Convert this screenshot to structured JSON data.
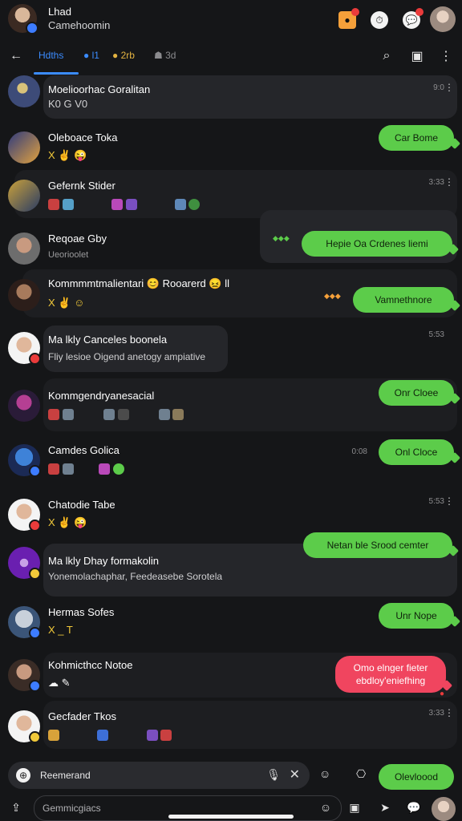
{
  "header": {
    "account_name": "Lhad",
    "account_sub": "Camehoomin",
    "icons": [
      "notification-icon",
      "timer-icon",
      "chat-bubble-icon"
    ]
  },
  "tabs": [
    {
      "label": "Hdths",
      "active": true
    },
    {
      "label": "l1"
    },
    {
      "label": "2rb"
    },
    {
      "label": "3d"
    }
  ],
  "rows": [
    {
      "name": "Moelioorhac Goralitan",
      "sub": "K0 G V0",
      "time": "9:0"
    },
    {
      "name": "Oleboace Toka",
      "sub": "X ✌ 😜",
      "reply": "Car Bome"
    },
    {
      "name": "Gefernk Stider",
      "sub": "",
      "time": "3:33"
    },
    {
      "name": "Reqoae Gby",
      "sub": "Ueorioolet",
      "reply": "Hepie Oa Crdenes liemi"
    },
    {
      "name": "Kommmmtmalientari",
      "sub": "Kommmmtmalientari 😊 Rooarerd 😖 ll",
      "sub2": "X ✌ ☺",
      "reply": "Vamnethnore"
    },
    {
      "name": "Ma lkly Canceles boonela",
      "sub": "Fliy lesioe Oigend anetogy ampiative",
      "time": "5:53"
    },
    {
      "name": "Kommgendryanesacial",
      "sub": "",
      "reply": "Onr Cloee"
    },
    {
      "name": "Camdes Golica",
      "sub": "",
      "time": "0:08",
      "reply": "Onl Cloce"
    },
    {
      "name": "Chatodie Tabe",
      "sub": "X ✌ 😜",
      "time": "5:53"
    },
    {
      "name": "Ma lkly Dhay formakolin",
      "sub": "Yonemolachaphar, Feedeasebe Sorotela",
      "reply": "Netan ble Srood cemter"
    },
    {
      "name": "Hermas Sofes",
      "sub": "X _ T",
      "reply": "Unr Nope"
    },
    {
      "name": "Kohmicthcc Notoe",
      "sub": "",
      "reply_red": [
        "Omo elnger fieter",
        "ebdloy'eniefhing"
      ]
    },
    {
      "name": "Gecfader Tkos",
      "sub": "",
      "time": "3:33"
    }
  ],
  "composer": {
    "text": "Reemerand",
    "send_label": "Olevloood"
  },
  "bottom": {
    "placeholder": "Gemmicgiacs"
  }
}
